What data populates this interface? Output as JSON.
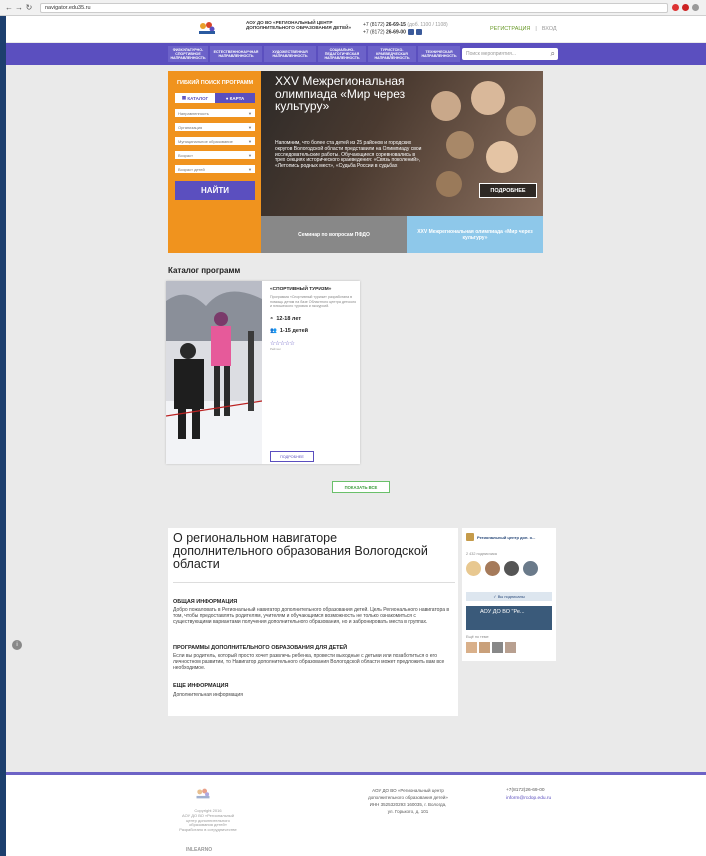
{
  "browser": {
    "url": "navigator.edu35.ru"
  },
  "header": {
    "org_name": "АОУ ДО ВО «РЕГИОНАЛЬНЫЙ ЦЕНТР ДОПОЛНИТЕЛЬНОГО ОБРАЗОВАНИЯ ДЕТЕЙ»",
    "phone1_prefix": "+7 (8172)",
    "phone1": "26-69-15",
    "phone1_extra": "(доб. 1100 / 1108)",
    "phone2_prefix": "+7 (8172)",
    "phone2": "26-69-00",
    "register": "РЕГИСТРАЦИЯ",
    "login": "ВХОД"
  },
  "menu": {
    "items": [
      "ФИЗКУЛЬТУРНО-СПОРТИВНОЕ НАПРАВЛЕННОСТЬ",
      "ЕСТЕСТВЕННОНАУЧНАЯ НАПРАВЛЕННОСТЬ",
      "ХУДОЖЕСТВЕННАЯ НАПРАВЛЕННОСТЬ",
      "СОЦИАЛЬНО-ПЕДАГОГИЧЕСКАЯ НАПРАВЛЕННОСТЬ",
      "ТУРИСТСКО-КРАЕВЕДЧЕСКАЯ НАПРАВЛЕННОСТЬ",
      "ТЕХНИЧЕСКАЯ НАПРАВЛЕННОСТЬ"
    ],
    "search_placeholder": "Поиск мероприятия..."
  },
  "filter": {
    "title": "ГИБКИЙ ПОИСК ПРОГРАММ",
    "tab_catalog": "КАТАЛОГ",
    "tab_map": "КАРТА",
    "selects": [
      "Направленность",
      "Организация",
      "Муниципальное образование",
      "Возраст",
      "Возраст детей"
    ],
    "find_button": "НАЙТИ"
  },
  "banner": {
    "title": "XXV Межрегиональная олимпиада «Мир через культуру»",
    "text": "Напомним, что более ста детей из 25 районов и городских округов Вологодской области представили на Олимпиаду свои исследовательские работы. Обучающиеся соревновались в трех секциях исторического краеведения: «Связь поколений», «Летопись родных мест», «Судьба России в судьбах",
    "more_button": "ПОДРОБНЕЕ",
    "sub1": "Семинар по вопросам ПФДО",
    "sub2": "XXV Межрегиональная олимпиада «Мир через культуру»"
  },
  "catalog": {
    "heading": "Каталог программ",
    "card": {
      "title": "«СПОРТИВНЫЙ ТУРИЗМ»",
      "desc": "Программа «Спортивный туризм» разработана в помощь детям на базе Областного центра детского и юношеского туризма и экскурсий.",
      "age": "12-18 лет",
      "kids": "1-15 детей",
      "stars": "☆☆☆☆☆",
      "rating_label": "Рейтинг",
      "more_button": "ПОДРОБНЕЕ"
    },
    "show_all": "ПОКАЗАТЬ ВСЕ"
  },
  "about": {
    "title": "О региональном навигаторе дополнительного образования Вологодской области",
    "sec1_h": "ОБЩАЯ ИНФОРМАЦИЯ",
    "sec1_t": "Добро пожаловать в Региональный навигатор дополнительного образования детей. Цель Регионального навигатора в том, чтобы предоставлять родителям, учителям и обучающимся возможность не только ознакомиться с существующими вариантами получения дополнительного образования, но и забронировать места в группах.",
    "sec2_h": "ПРОГРАММЫ ДОПОЛНИТЕЛЬНОГО ОБРАЗОВАНИЯ ДЛЯ ДЕТЕЙ",
    "sec2_t": "Если вы родитель, который просто хочет развлечь ребенка, провести выходные с детьми или позаботиться о его личностном развитии, то Навигатор дополнительного образования Вологодской области может предложить вам все необходимое.",
    "sec3_h": "ЕЩЕ ИНФОРМАЦИЯ",
    "sec3_t": "Дополнительная информация"
  },
  "widget": {
    "name": "Региональный центр доп. о...",
    "subs": "2 432 подписчика",
    "subscribe": "✓ Вы подписаны",
    "post_title": "АОУ ДО ВО \"Ре...",
    "more_label": "Ещё по теме"
  },
  "footer": {
    "copyright": "Copyright 2016",
    "org": "АОУ ДО ВО «Региональный центр дополнительного образования детей»",
    "developer_label": "Разработано в сотрудничестве",
    "developer": "INLEARNO",
    "address": "АОУ ДО ВО «Региональный центр дополнительного образования детей» ИНН 3525320293 160035, г. Вологда, ул. Горького, д. 101",
    "phone": "+7(8172)26-69-00",
    "email": "inform@rcdop.edu.ru"
  },
  "colors": {
    "accent": "#5b4fbf",
    "orange": "#f0931e",
    "green": "#6a9a2a",
    "blue_light": "#8ec8ea"
  }
}
